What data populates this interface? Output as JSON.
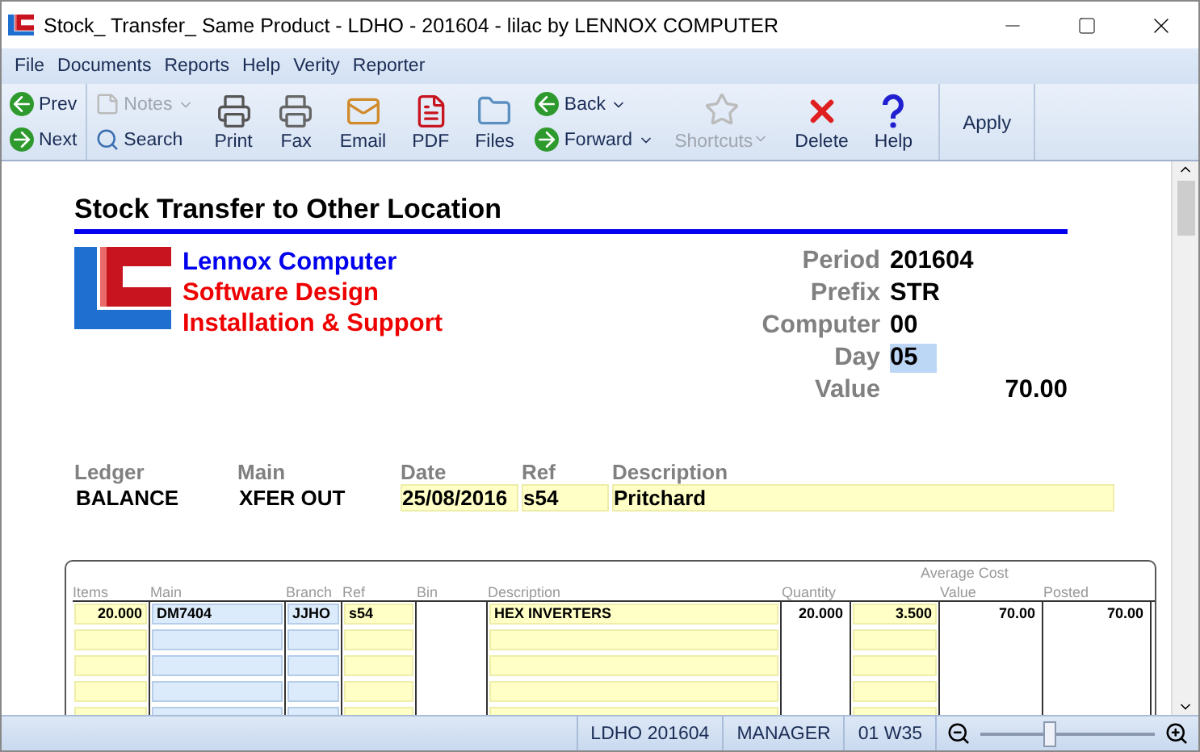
{
  "window": {
    "title": "Stock_ Transfer_ Same Product - LDHO - 201604 - lilac by LENNOX COMPUTER"
  },
  "menu": [
    "File",
    "Documents",
    "Reports",
    "Help",
    "Verity",
    "Reporter"
  ],
  "toolbar": [
    {
      "kind": "pair",
      "items": [
        {
          "label": "Prev",
          "disabled": false
        },
        {
          "label": "Next",
          "disabled": false
        }
      ]
    },
    {
      "kind": "pair",
      "items": [
        {
          "label": "Notes",
          "disabled": true,
          "dropdown": true
        },
        {
          "label": "Search",
          "disabled": false
        }
      ]
    },
    {
      "kind": "big",
      "label": "Print",
      "disabled": false
    },
    {
      "kind": "big",
      "label": "Fax",
      "disabled": false
    },
    {
      "kind": "big",
      "label": "Email",
      "disabled": false
    },
    {
      "kind": "big",
      "label": "PDF",
      "disabled": false
    },
    {
      "kind": "big",
      "label": "Files",
      "disabled": false
    },
    {
      "kind": "pair",
      "items": [
        {
          "label": "Back",
          "disabled": false,
          "dropdown": true
        },
        {
          "label": "Forward",
          "disabled": false,
          "dropdown": true
        }
      ]
    },
    {
      "kind": "big",
      "label": "Shortcuts",
      "disabled": true,
      "dropdown": true
    },
    {
      "kind": "big",
      "label": "Delete",
      "disabled": false
    },
    {
      "kind": "big",
      "label": "Help",
      "disabled": false
    },
    {
      "kind": "text",
      "label": "Apply",
      "disabled": false
    }
  ],
  "form": {
    "title": "Stock Transfer to Other Location",
    "company": [
      "Lennox Computer",
      "Software Design",
      "Installation & Support"
    ],
    "fields": [
      {
        "label": "Period",
        "value": "201604",
        "focused": false
      },
      {
        "label": "Prefix",
        "value": "STR",
        "focused": false
      },
      {
        "label": "Computer",
        "value": "00",
        "focused": false
      },
      {
        "label": "Day",
        "value": "05",
        "focused": true
      },
      {
        "label": "Value",
        "value": "70.00",
        "focused": false
      }
    ],
    "ledger": [
      {
        "label": "Ledger",
        "value": "BALANCE",
        "editable": false
      },
      {
        "label": "Main",
        "value": "XFER OUT",
        "editable": false
      },
      {
        "label": "Date",
        "value": "25/08/2016",
        "editable": true
      },
      {
        "label": "Ref",
        "value": "s54",
        "editable": true
      },
      {
        "label": "Description",
        "value": "Pritchard",
        "editable": true
      }
    ]
  },
  "table": {
    "group_heading": "Average Cost",
    "columns": [
      {
        "label": "Items",
        "kind": "entry"
      },
      {
        "label": "Main",
        "kind": "lookup"
      },
      {
        "label": "Branch",
        "kind": "lookup"
      },
      {
        "label": "Ref",
        "kind": "entry"
      },
      {
        "label": "Bin",
        "kind": "plain"
      },
      {
        "label": "Description",
        "kind": "entry"
      },
      {
        "label": "Quantity",
        "kind": "plain"
      },
      {
        "kind": "entry"
      },
      {
        "label": "Value",
        "kind": "plain"
      },
      {
        "label": "Posted",
        "kind": "plain"
      }
    ],
    "rows": [
      [
        "20.000",
        "DM7404",
        "JJHO",
        "s54",
        "",
        "HEX INVERTERS",
        "20.000",
        "3.500",
        "70.00",
        "70.00"
      ]
    ]
  },
  "status_bar": {
    "items": [
      "LDHO 201604",
      "MANAGER",
      "01 W35"
    ],
    "zoom": {
      "level": 0.4
    }
  }
}
